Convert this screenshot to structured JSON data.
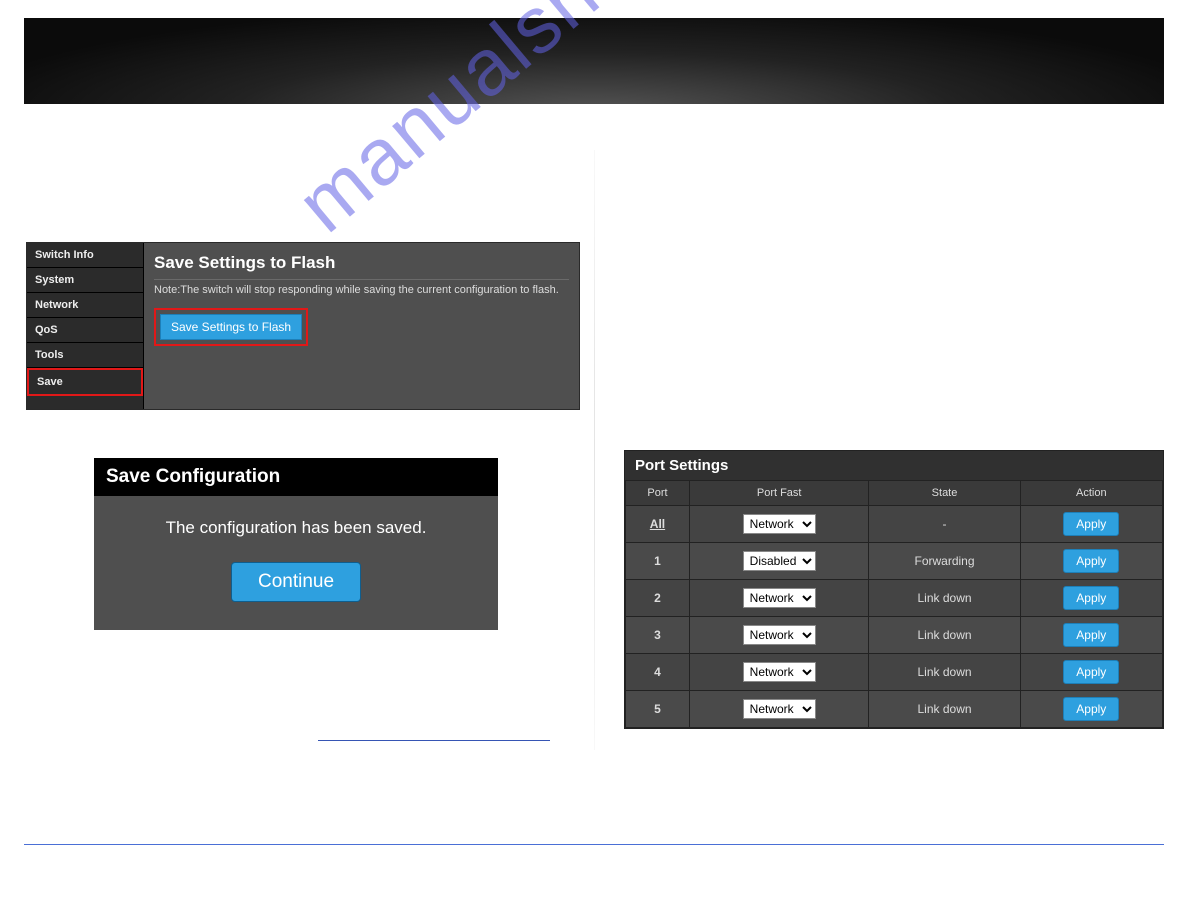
{
  "watermark": "manualshive.com",
  "shot1": {
    "sidebar": [
      "Switch Info",
      "System",
      "Network",
      "QoS",
      "Tools",
      "Save"
    ],
    "title": "Save Settings to Flash",
    "note": "Note:The switch will stop responding while saving the current configuration to flash.",
    "button": "Save Settings to Flash"
  },
  "shot2": {
    "title": "Save Configuration",
    "message": "The configuration has been saved.",
    "button": "Continue"
  },
  "port": {
    "title": "Port Settings",
    "headers": [
      "Port",
      "Port Fast",
      "State",
      "Action"
    ],
    "apply_label": "Apply",
    "options": [
      "Network",
      "Disabled"
    ],
    "rows": [
      {
        "port": "All",
        "fast": "Network",
        "state": "-"
      },
      {
        "port": "1",
        "fast": "Disabled",
        "state": "Forwarding"
      },
      {
        "port": "2",
        "fast": "Network",
        "state": "Link down"
      },
      {
        "port": "3",
        "fast": "Network",
        "state": "Link down"
      },
      {
        "port": "4",
        "fast": "Network",
        "state": "Link down"
      },
      {
        "port": "5",
        "fast": "Network",
        "state": "Link down"
      }
    ]
  }
}
